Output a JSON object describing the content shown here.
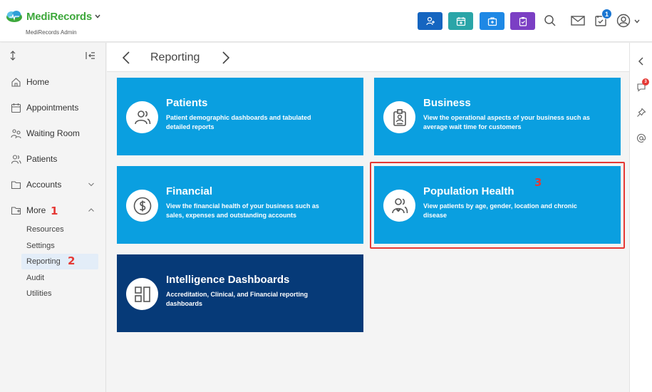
{
  "brand": {
    "name": "MediRecords",
    "subtitle": "MediRecords Admin"
  },
  "header": {
    "quick_actions": [
      {
        "icon": "add-patient-icon",
        "color": "#1565c0"
      },
      {
        "icon": "calendar-plus-icon",
        "color": "#2aa5a8"
      },
      {
        "icon": "medical-kit-icon",
        "color": "#1e88e5"
      },
      {
        "icon": "clipboard-icon",
        "color": "#7b3fc4"
      }
    ],
    "tasks_badge": "1"
  },
  "sidebar": {
    "items": [
      {
        "label": "Home",
        "icon": "home-icon"
      },
      {
        "label": "Appointments",
        "icon": "calendar-icon"
      },
      {
        "label": "Waiting Room",
        "icon": "waiting-room-icon"
      },
      {
        "label": "Patients",
        "icon": "patients-icon"
      },
      {
        "label": "Accounts",
        "icon": "folder-icon"
      },
      {
        "label": "More",
        "icon": "folder-plus-icon"
      }
    ],
    "more_items": [
      {
        "label": "Resources"
      },
      {
        "label": "Settings"
      },
      {
        "label": "Reporting",
        "active": true
      },
      {
        "label": "Audit"
      },
      {
        "label": "Utilities"
      }
    ]
  },
  "steps": {
    "one": "1",
    "two": "2",
    "three": "3"
  },
  "breadcrumb": {
    "title": "Reporting"
  },
  "rail": {
    "comments_badge": "3"
  },
  "cards": [
    {
      "title": "Patients",
      "description": "Patient demographic dashboards and tabulated detailed reports",
      "icon": "users-icon"
    },
    {
      "title": "Business",
      "description": "View the operational aspects of your business such as average wait time for customers",
      "icon": "badge-icon"
    },
    {
      "title": "Financial",
      "description": "View the financial health of your business such as sales, expenses and outstanding accounts",
      "icon": "dollar-icon"
    },
    {
      "title": "Population Health",
      "description": "View patients by age, gender, location and chronic disease",
      "icon": "population-icon"
    },
    {
      "title": "Intelligence Dashboards",
      "description": "Accreditation, Clinical, and Financial reporting dashboards",
      "icon": "dashboard-icon"
    }
  ],
  "colors": {
    "card": "#0a9fe0",
    "card_dark": "#063a78",
    "brand": "#3da83b",
    "highlight": "#e53935"
  }
}
